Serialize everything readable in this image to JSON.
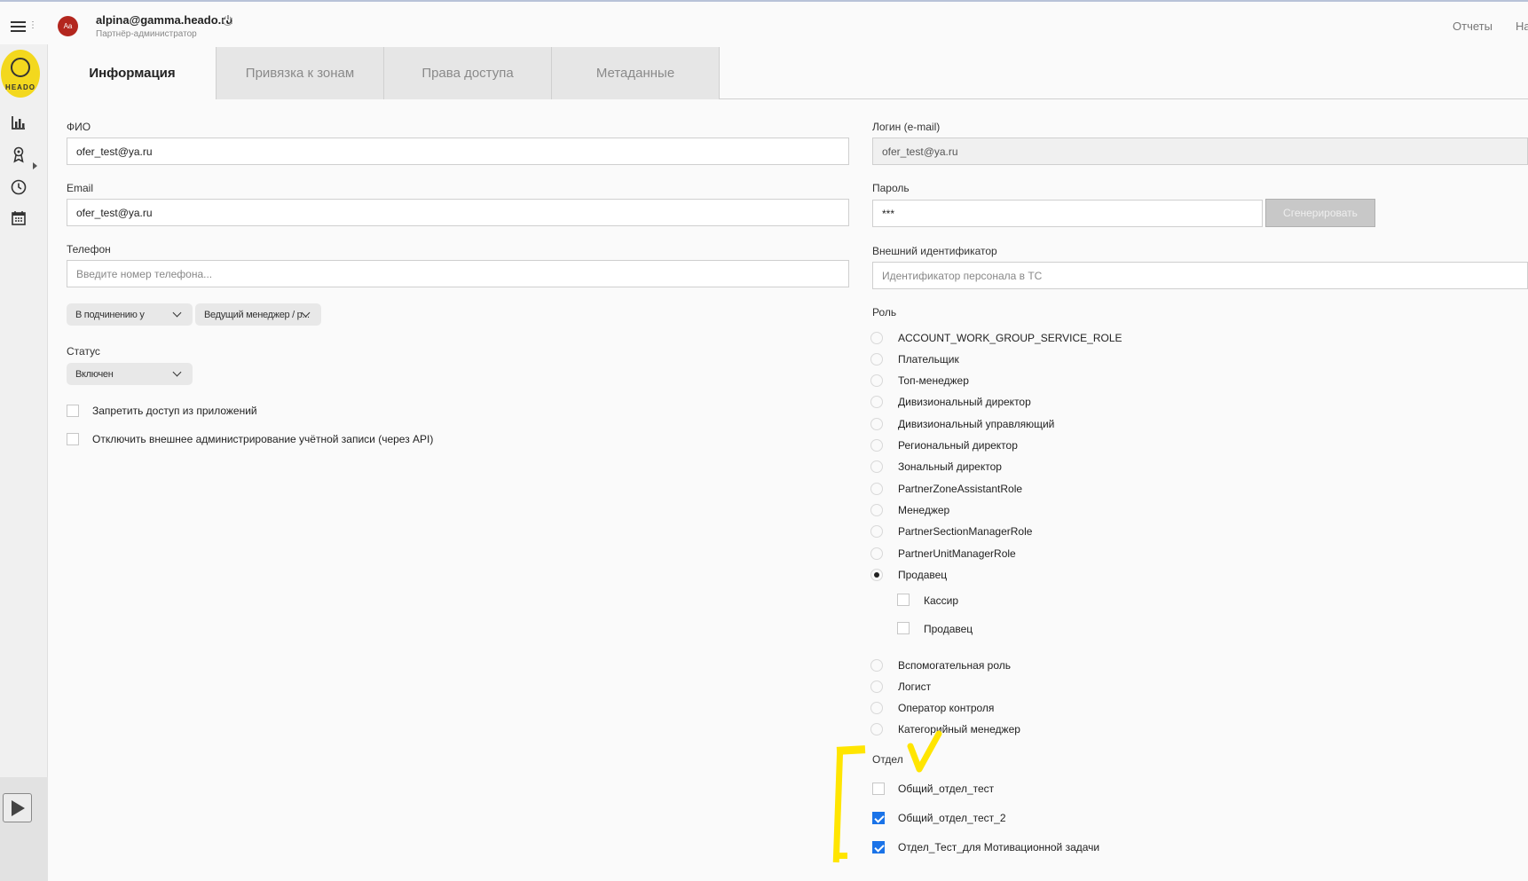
{
  "header": {
    "avatar_initials": "Aa",
    "user_email": "alpina@gamma.heado.ru",
    "user_role": "Партнёр-администратор",
    "nav_reports": "Отчеты",
    "nav_next_partial": "На"
  },
  "sidebar": {
    "logo_text": "HEADO",
    "icons": [
      "bar-chart-icon",
      "award-icon",
      "clock-icon",
      "calendar-icon"
    ]
  },
  "tabs": [
    {
      "label": "Информация",
      "active": true
    },
    {
      "label": "Привязка к зонам",
      "active": false
    },
    {
      "label": "Права доступа",
      "active": false
    },
    {
      "label": "Метаданные",
      "active": false
    }
  ],
  "form": {
    "fio_label": "ФИО",
    "fio_value": "ofer_test@ya.ru",
    "email_label": "Email",
    "email_value": "ofer_test@ya.ru",
    "phone_label": "Телефон",
    "phone_placeholder": "Введите номер телефона...",
    "subordination_value": "В подчинению у",
    "manager_value": "Ведущий менеджер / р...",
    "status_label": "Статус",
    "status_value": "Включен",
    "deny_app_access": "Запретить доступ из приложений",
    "disable_external_admin": "Отключить внешнее администрирование учётной записи (через API)",
    "login_label": "Логин (e-mail)",
    "login_value": "ofer_test@ya.ru",
    "password_label": "Пароль",
    "password_value": "***",
    "generate_button": "Сгенерировать",
    "external_id_label": "Внешний идентификатор",
    "external_id_placeholder": "Идентификатор персонала в ТС",
    "role_label": "Роль",
    "roles_top": [
      "ACCOUNT_WORK_GROUP_SERVICE_ROLE",
      "Плательщик",
      "Топ-менеджер",
      "Дивизиональный директор",
      "Дивизиональный управляющий",
      "Региональный директор",
      "Зональный директор",
      "PartnerZoneAssistantRole",
      "Менеджер",
      "PartnerSectionManagerRole",
      "PartnerUnitManagerRole",
      "Продавец"
    ],
    "selected_role": "Продавец",
    "subroles": [
      "Кассир",
      "Продавец"
    ],
    "roles_bottom": [
      "Вспомогательная роль",
      "Логист",
      "Оператор контроля",
      "Категорийный менеджер"
    ],
    "department_label": "Отдел",
    "departments": [
      {
        "label": "Общий_отдел_тест",
        "checked": false
      },
      {
        "label": "Общий_отдел_тест_2",
        "checked": true
      },
      {
        "label": "Отдел_Тест_для Мотивационной задачи",
        "checked": true
      }
    ]
  }
}
